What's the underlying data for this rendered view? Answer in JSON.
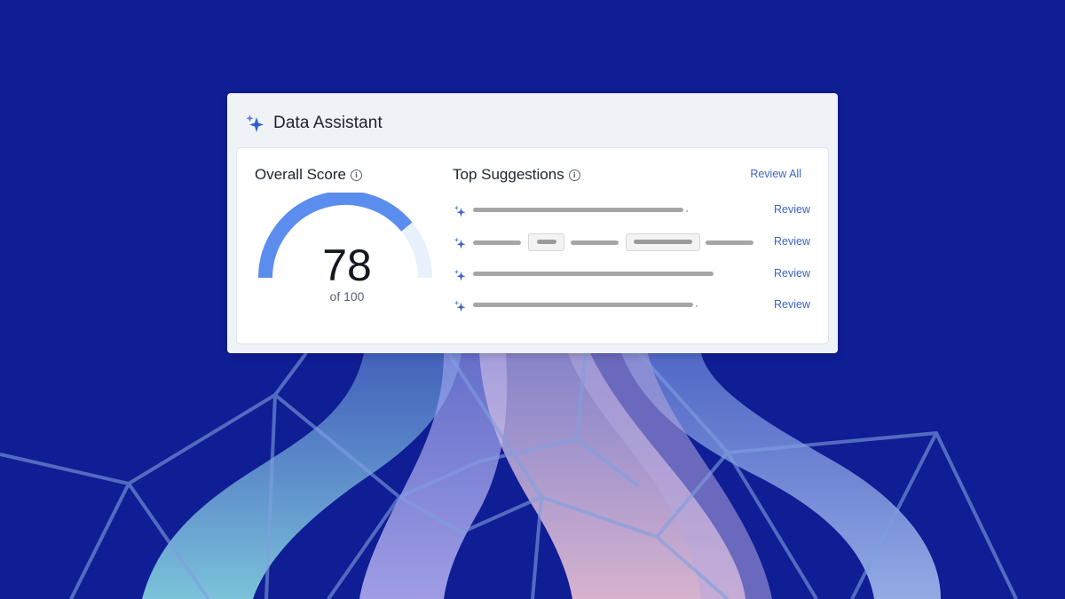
{
  "colors": {
    "background": "#0f1e94",
    "accent": "#3b63c9",
    "gauge_fill": "#5b8def",
    "gauge_track": "#e8f1fd",
    "ribbon_teal": "#8fe0e6",
    "ribbon_lavender": "#b9b3f3",
    "ribbon_pink": "#f2c7d6",
    "ribbon_light": "#aac4f2",
    "mesh_line": "#6d8fd8"
  },
  "card": {
    "title": "Data Assistant",
    "title_icon": "sparkle-icon"
  },
  "score": {
    "label": "Overall Score",
    "info_icon": "info-icon",
    "value": 78,
    "value_text": "78",
    "max_text": "of 100"
  },
  "suggestions": {
    "label": "Top Suggestions",
    "info_icon": "info-icon",
    "review_all": "Review All",
    "items": [
      {
        "icon": "sparkle-icon",
        "action": "Review"
      },
      {
        "icon": "sparkle-icon",
        "action": "Review"
      },
      {
        "icon": "sparkle-icon",
        "action": "Review"
      },
      {
        "icon": "sparkle-icon",
        "action": "Review"
      }
    ]
  }
}
